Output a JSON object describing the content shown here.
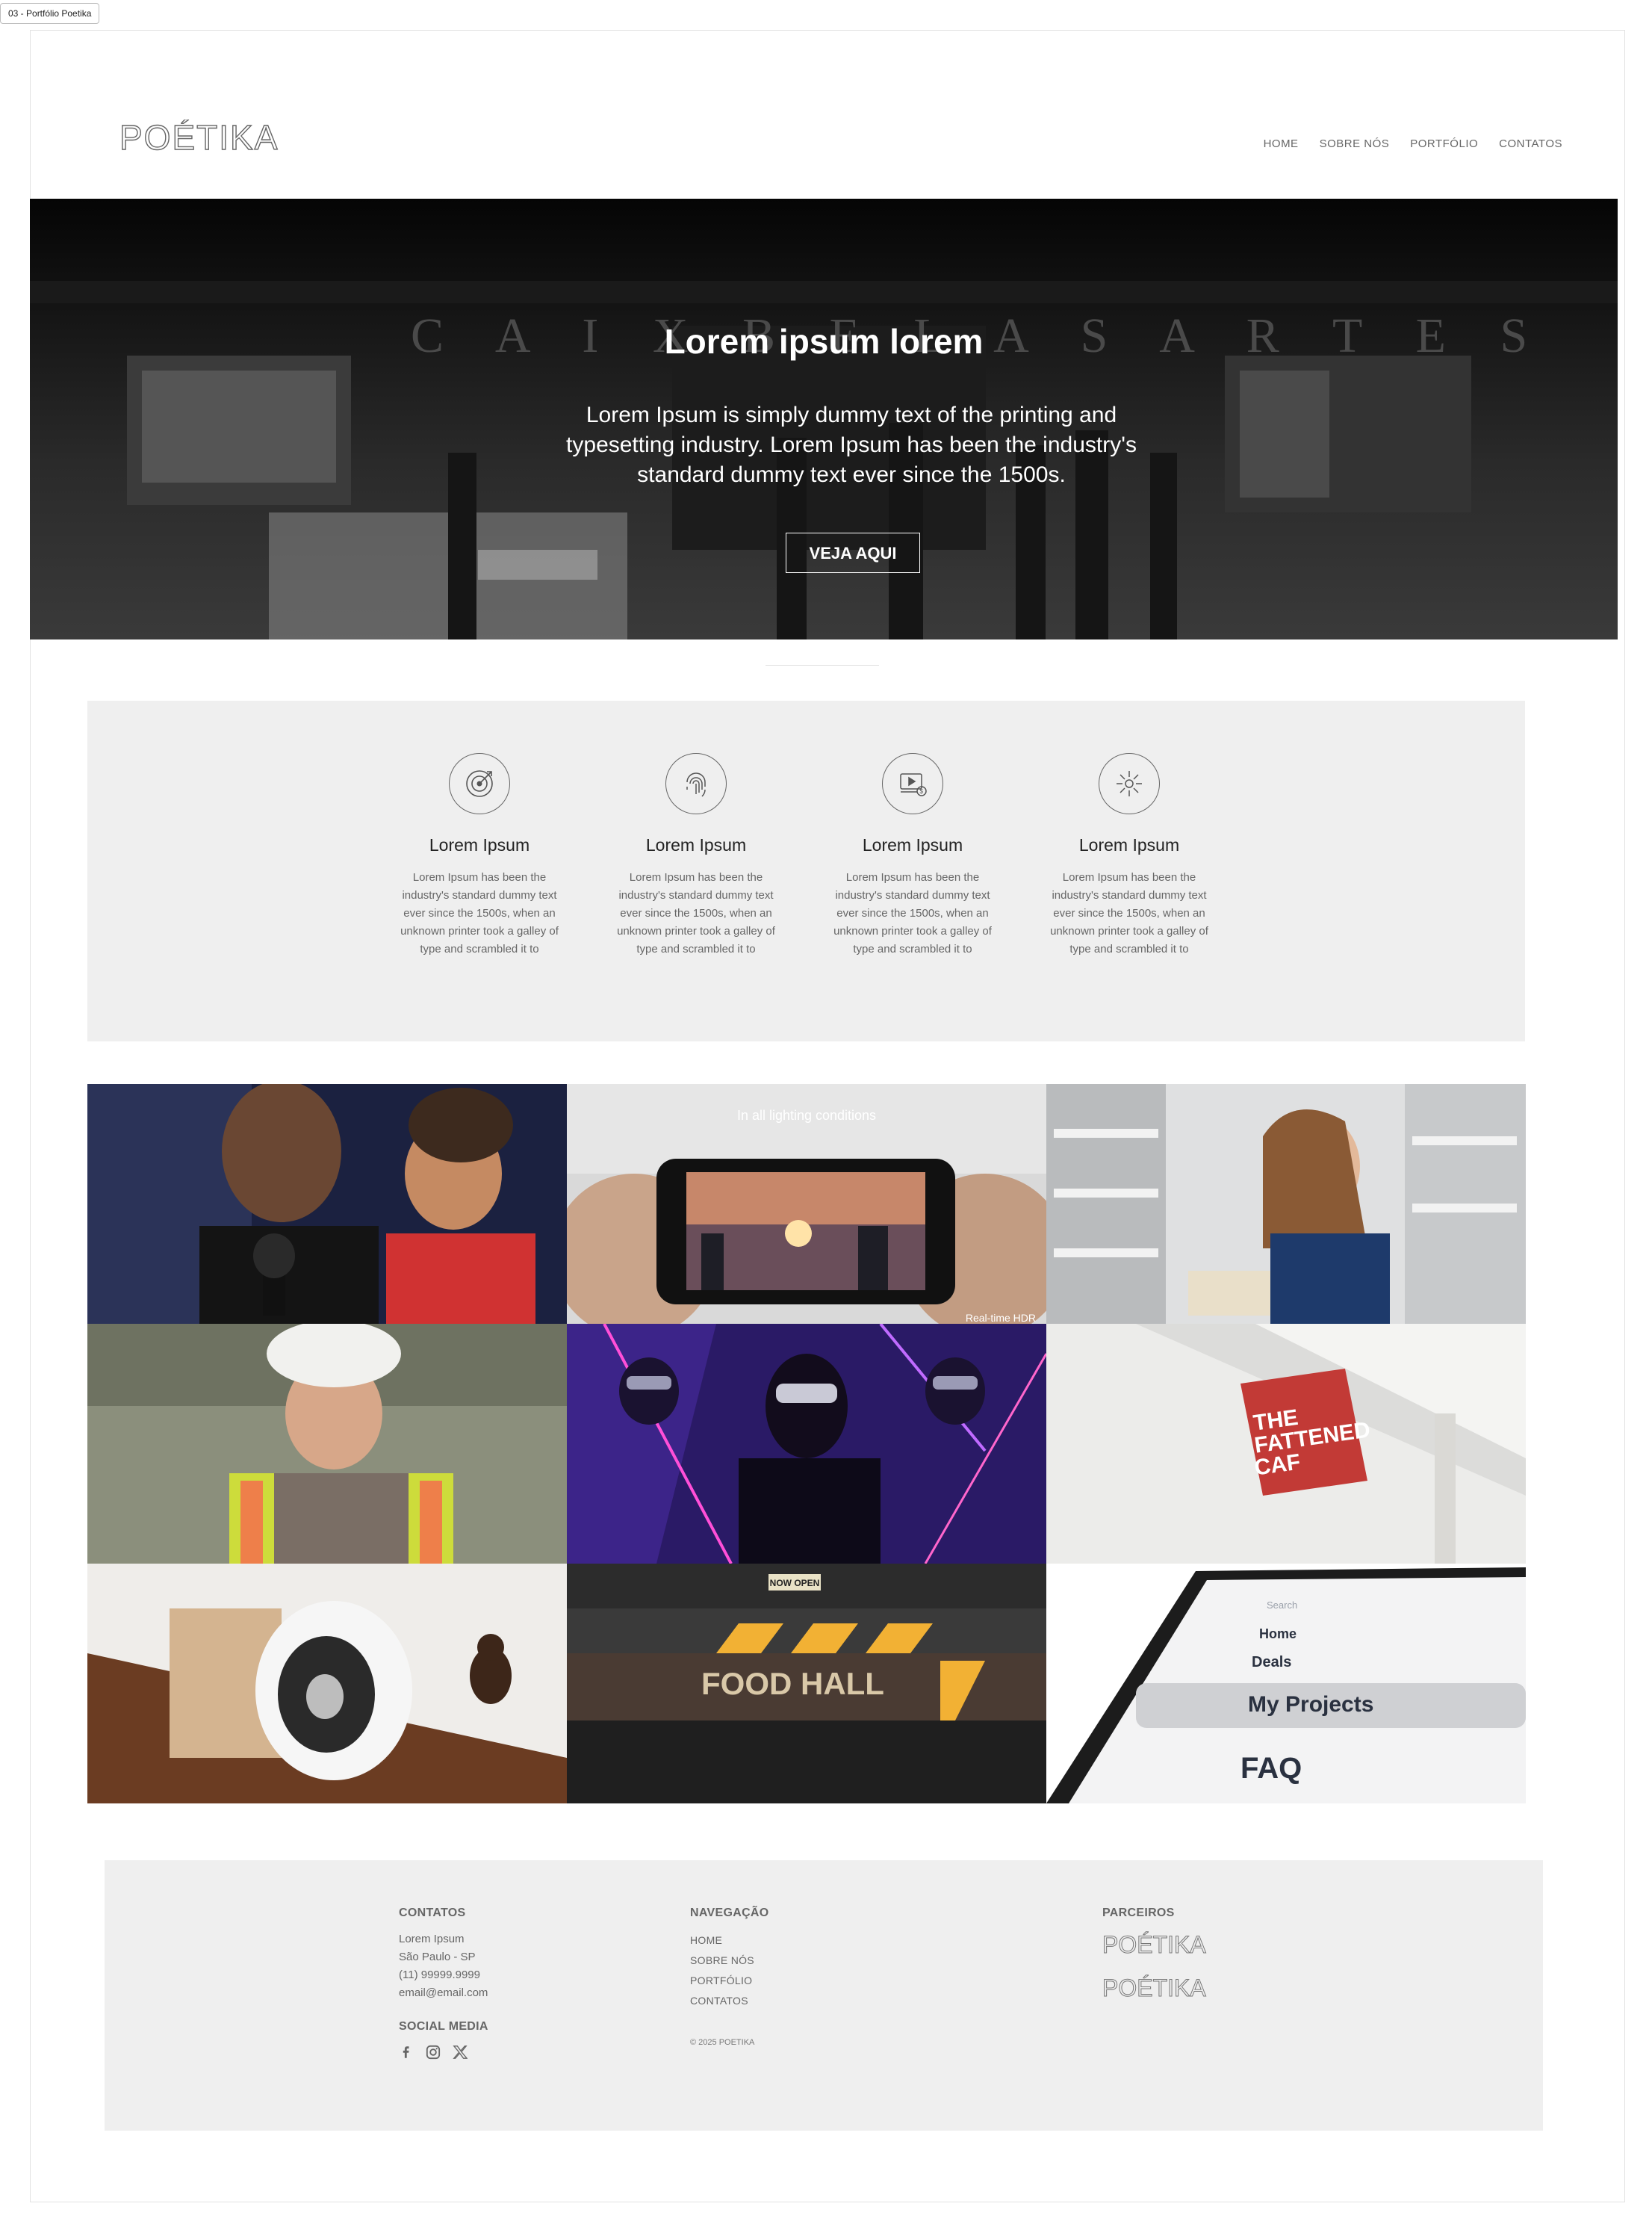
{
  "frame_label": "03 - Portfólio Poetika",
  "brand": {
    "logo_text": "POÉTIKA"
  },
  "nav": {
    "items": [
      "HOME",
      "SOBRE NÓS",
      "PORTFÓLIO",
      "CONTATOS"
    ]
  },
  "hero": {
    "background_sign": "C A I X   B E L A S A R T E S",
    "title": "Lorem ipsum lorem",
    "text": "Lorem Ipsum is simply dummy text of the printing and typesetting industry. Lorem Ipsum has been the industry's standard dummy text ever since the 1500s.",
    "button": "VEJA AQUI"
  },
  "features": [
    {
      "icon": "target-icon",
      "title": "Lorem Ipsum",
      "text": "Lorem Ipsum has been the industry's standard dummy text ever since the 1500s, when an unknown printer took a galley of type and scrambled it to"
    },
    {
      "icon": "fingerprint-icon",
      "title": "Lorem Ipsum",
      "text": "Lorem Ipsum has been the industry's standard dummy text ever since the 1500s, when an unknown printer took a galley of type and scrambled it to"
    },
    {
      "icon": "video-money-icon",
      "title": "Lorem Ipsum",
      "text": "Lorem Ipsum has been the industry's standard dummy text ever since the 1500s, when an unknown printer took a galley of type and scrambled it to"
    },
    {
      "icon": "idea-burst-icon",
      "title": "Lorem Ipsum",
      "text": "Lorem Ipsum has been the industry's standard dummy text ever since the 1500s, when an unknown printer took a galley of type and scrambled it to"
    }
  ],
  "gallery": {
    "phone_caption": "In all lighting conditions",
    "phone_subcaption": "Real-time HDR",
    "sign_text_1": "THE",
    "sign_text_2": "FATTENED",
    "sign_text_3": "CAF",
    "food_hall": "FOOD HALL",
    "now_open": "NOW OPEN",
    "app_menu": [
      "Search",
      "Home",
      "Deals",
      "My Projects",
      "FAQ"
    ]
  },
  "footer": {
    "contacts": {
      "heading": "CONTATOS",
      "lines": [
        "Lorem Ipsum",
        "São Paulo - SP",
        "(11) 99999.9999",
        "email@email.com"
      ]
    },
    "social": {
      "heading": "SOCIAL MEDIA",
      "icons": [
        "facebook-icon",
        "instagram-icon",
        "x-twitter-icon"
      ]
    },
    "navigation": {
      "heading": "NAVEGAÇÃO",
      "items": [
        "HOME",
        "SOBRE NÓS",
        "PORTFÓLIO",
        "CONTATOS"
      ],
      "copyright": "© 2025 POETIKA"
    },
    "partners": {
      "heading": "PARCEIROS",
      "logos": [
        "POÉTIKA",
        "POÉTIKA"
      ]
    }
  }
}
